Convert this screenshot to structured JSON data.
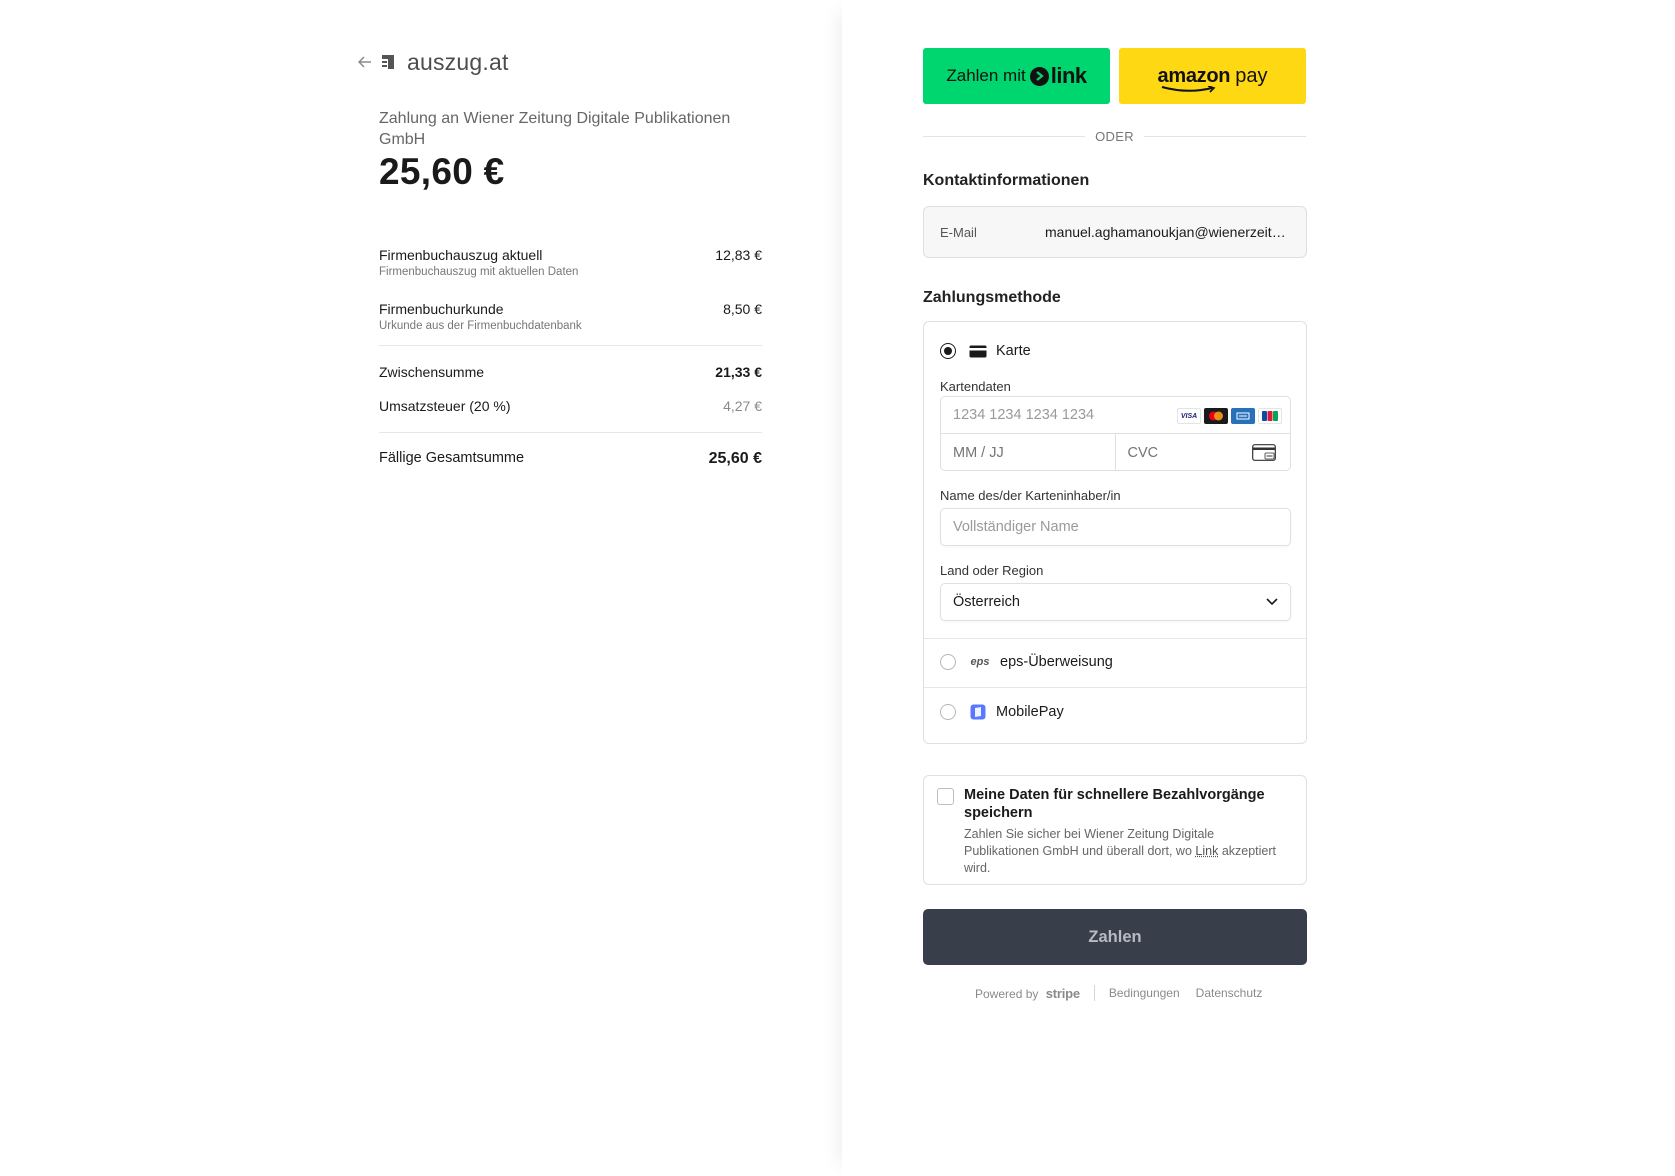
{
  "merchant": {
    "name": "auszug.at",
    "pay_to": "Zahlung an Wiener Zeitung Digitale Publikationen GmbH",
    "amount": "25,60 €"
  },
  "items": [
    {
      "name": "Firmenbuchauszug aktuell",
      "desc": "Firmenbuchauszug mit aktuellen Daten",
      "price": "12,83 €"
    },
    {
      "name": "Firmenbuchurkunde",
      "desc": "Urkunde aus der Firmenbuchdatenbank",
      "price": "8,50 €"
    }
  ],
  "summary": {
    "subtotal_label": "Zwischensumme",
    "subtotal_value": "21,33 €",
    "tax_label": "Umsatzsteuer (20 %)",
    "tax_value": "4,27 €",
    "total_label": "Fällige Gesamtsumme",
    "total_value": "25,60 €"
  },
  "express": {
    "link_prefix": "Zahlen mit",
    "link_word": "link",
    "amazon_word": "amazon",
    "amazon_pay": "pay",
    "or_label": "ODER"
  },
  "contact": {
    "title": "Kontaktinformationen",
    "email_label": "E-Mail",
    "email_value": "manuel.aghamanoukjan@wienerzeitung.at"
  },
  "payment": {
    "title": "Zahlungsmethode",
    "card_label": "Karte",
    "card_data_label": "Kartendaten",
    "card_number_placeholder": "1234 1234 1234 1234",
    "expiry_placeholder": "MM / JJ",
    "cvc_placeholder": "CVC",
    "card_brands": [
      "VISA",
      "MC",
      "AMEX",
      "JCB"
    ],
    "holder_label": "Name des/der Karteninhaber/in",
    "holder_placeholder": "Vollständiger Name",
    "country_label": "Land oder Region",
    "country_value": "Österreich",
    "eps_label": "eps-Überweisung",
    "eps_logo_text": "eps",
    "mobilepay_label": "MobilePay"
  },
  "save": {
    "title": "Meine Daten für schnellere Bezahlvorgänge speichern",
    "desc_prefix": "Zahlen Sie sicher bei Wiener Zeitung Digitale Publikationen GmbH und überall dort, wo",
    "desc_link": "Link",
    "desc_suffix": "akzeptiert wird."
  },
  "pay_button": "Zahlen",
  "footer": {
    "powered_by": "Powered by",
    "stripe": "stripe",
    "terms": "Bedingungen",
    "privacy": "Datenschutz"
  },
  "colors": {
    "link_green": "#00d66f",
    "amazon_yellow": "#ffd814",
    "pay_button": "#393e4b"
  }
}
